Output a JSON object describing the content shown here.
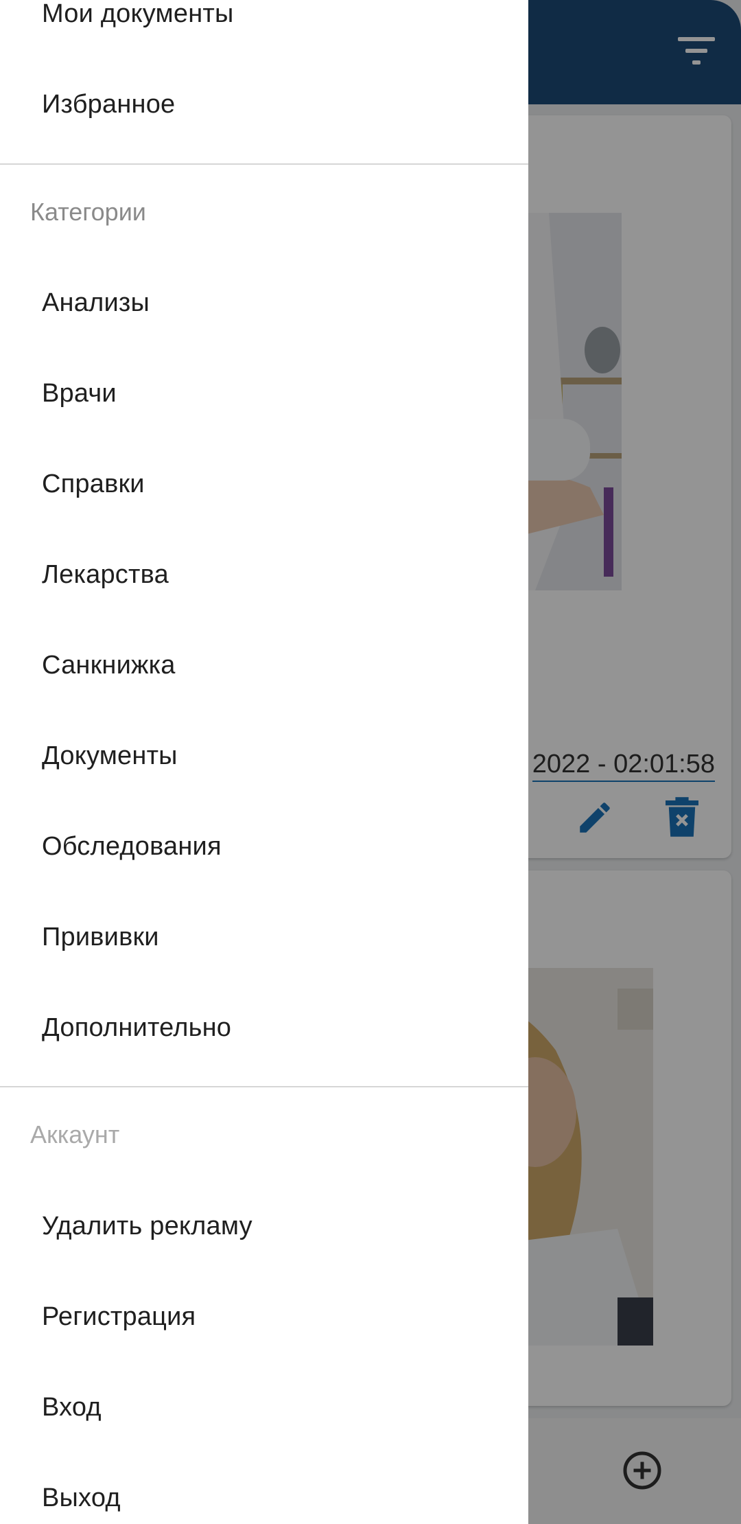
{
  "background": {
    "card1": {
      "date": "2022 - 02:01:58"
    }
  },
  "drawer": {
    "items_top": [
      {
        "label": "Мои документы"
      },
      {
        "label": "Избранное"
      }
    ],
    "categories_header": "Категории",
    "categories": [
      {
        "label": "Анализы"
      },
      {
        "label": "Врачи"
      },
      {
        "label": "Справки"
      },
      {
        "label": "Лекарства"
      },
      {
        "label": "Санкнижка"
      },
      {
        "label": "Документы"
      },
      {
        "label": "Обследования"
      },
      {
        "label": "Прививки"
      },
      {
        "label": "Дополнительно"
      }
    ],
    "account_header": "Аккаунт",
    "account": [
      {
        "label": "Удалить рекламу"
      },
      {
        "label": "Регистрация"
      },
      {
        "label": "Вход"
      },
      {
        "label": "Выход"
      }
    ]
  },
  "colors": {
    "appbar": "#1c4a78",
    "accent": "#1a73b8",
    "scrim": "rgba(0,0,0,0.42)"
  }
}
